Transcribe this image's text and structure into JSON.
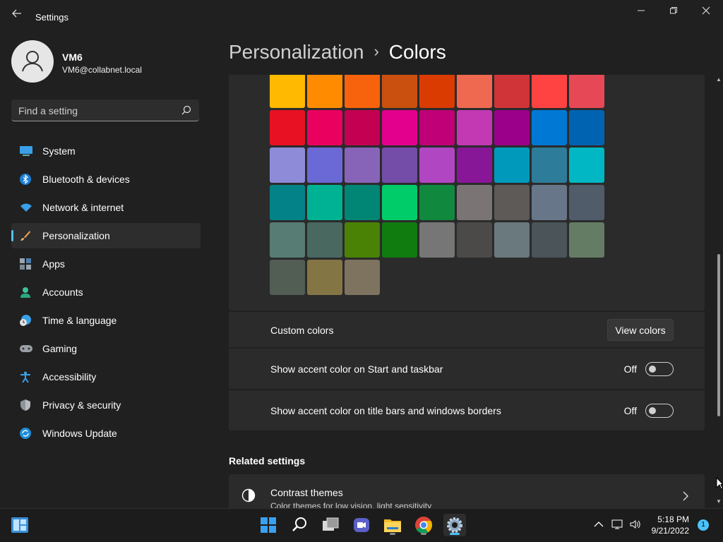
{
  "window": {
    "back_icon": "back-arrow-icon",
    "title": "Settings",
    "controls": [
      "minimize",
      "maximize",
      "close"
    ]
  },
  "profile": {
    "name": "VM6",
    "email": "VM6@collabnet.local"
  },
  "search": {
    "placeholder": "Find a setting"
  },
  "sidebar": {
    "items": [
      {
        "label": "System",
        "icon": "system-icon"
      },
      {
        "label": "Bluetooth & devices",
        "icon": "bluetooth-icon"
      },
      {
        "label": "Network & internet",
        "icon": "wifi-icon"
      },
      {
        "label": "Personalization",
        "icon": "brush-icon",
        "active": true
      },
      {
        "label": "Apps",
        "icon": "apps-icon"
      },
      {
        "label": "Accounts",
        "icon": "accounts-icon"
      },
      {
        "label": "Time & language",
        "icon": "clock-globe-icon"
      },
      {
        "label": "Gaming",
        "icon": "gamepad-icon"
      },
      {
        "label": "Accessibility",
        "icon": "accessibility-icon"
      },
      {
        "label": "Privacy & security",
        "icon": "shield-icon"
      },
      {
        "label": "Windows Update",
        "icon": "update-icon"
      }
    ]
  },
  "header": {
    "parent": "Personalization",
    "separator": "›",
    "current": "Colors"
  },
  "accent_colors": [
    "#ffb900",
    "#ff8c00",
    "#f7630c",
    "#ca5010",
    "#da3b01",
    "#ef6950",
    "#d13438",
    "#ff4343",
    "#e74856",
    "#e81123",
    "#ea005e",
    "#c30052",
    "#e3008c",
    "#bf0077",
    "#c239b3",
    "#9a0089",
    "#0078d4",
    "#0063b1",
    "#8e8cd8",
    "#6b69d6",
    "#8764b8",
    "#744da9",
    "#b146c2",
    "#881798",
    "#0099bc",
    "#2d7d9a",
    "#00b7c3",
    "#038387",
    "#00b294",
    "#018574",
    "#00cc6a",
    "#10893e",
    "#7a7574",
    "#5d5a58",
    "#68768a",
    "#515c6b",
    "#567c73",
    "#486860",
    "#498205",
    "#107c10",
    "#767676",
    "#4c4a48",
    "#69797e",
    "#4a5459",
    "#647c64",
    "#525e54",
    "#847545",
    "#7e735f"
  ],
  "custom_colors": {
    "label": "Custom colors",
    "button": "View colors"
  },
  "accent_start": {
    "label": "Show accent color on Start and taskbar",
    "state": "Off",
    "on": false
  },
  "accent_titlebars": {
    "label": "Show accent color on title bars and windows borders",
    "state": "Off",
    "on": false
  },
  "related": {
    "heading": "Related settings",
    "items": [
      {
        "title": "Contrast themes",
        "subtitle": "Color themes for low vision, light sensitivity",
        "icon": "contrast-icon"
      }
    ]
  },
  "taskbar": {
    "apps": [
      "start-icon",
      "search-icon",
      "task-view-icon",
      "chat-icon",
      "file-explorer-icon",
      "chrome-icon",
      "settings-icon"
    ],
    "time": "5:18 PM",
    "date": "9/21/2022",
    "notification_count": "1"
  }
}
